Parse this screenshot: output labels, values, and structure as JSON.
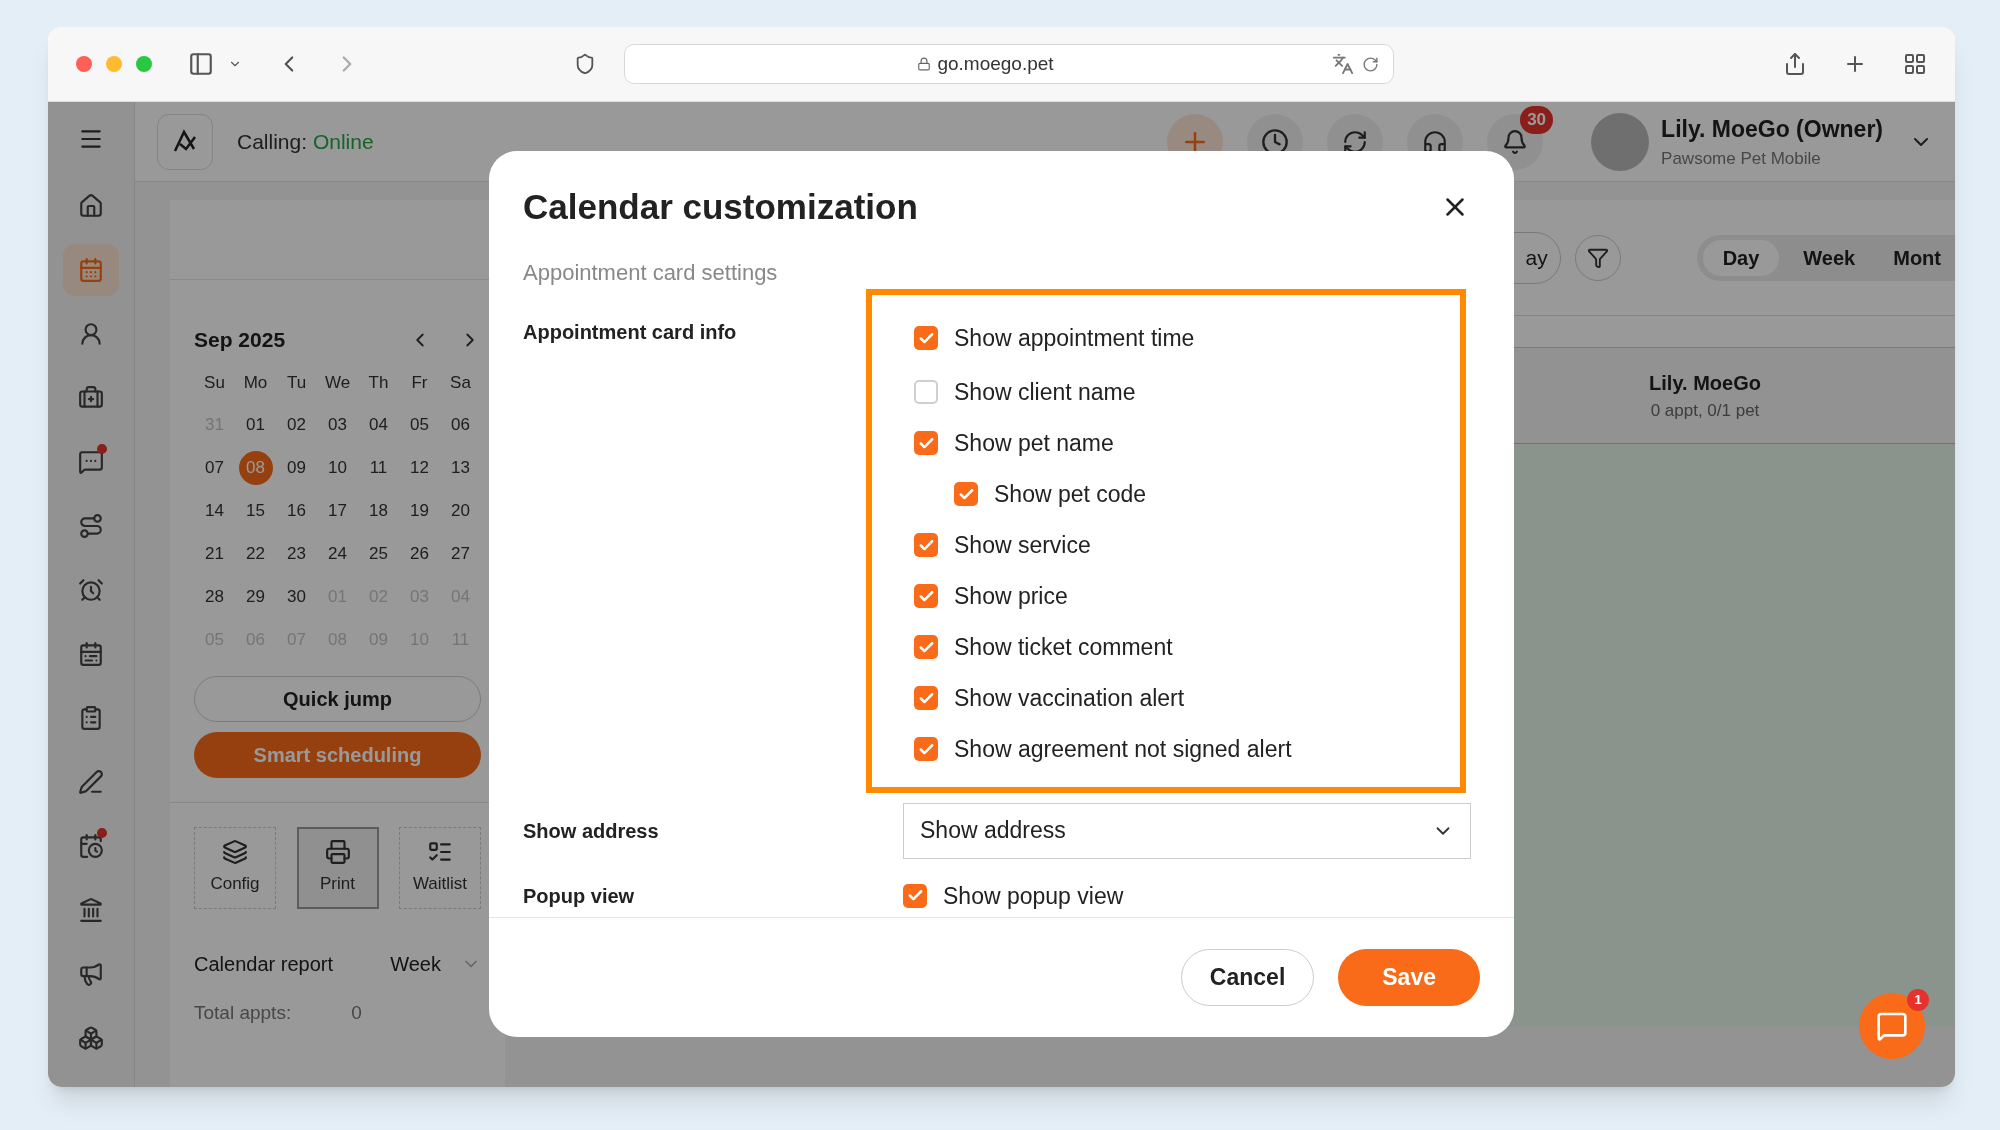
{
  "browser": {
    "url": "go.moego.pet"
  },
  "header": {
    "calling_label": "Calling:",
    "calling_status": "Online",
    "notification_count": "30",
    "user_name": "Lily. MoeGo (Owner)",
    "business": "Pawsome Pet Mobile"
  },
  "sidebar": {
    "items": [
      {
        "selected": false,
        "badge": false
      },
      {
        "selected": true,
        "badge": false
      },
      {
        "selected": false,
        "badge": false
      },
      {
        "selected": false,
        "badge": false
      },
      {
        "selected": false,
        "badge": true
      },
      {
        "selected": false,
        "badge": false
      },
      {
        "selected": false,
        "badge": false
      },
      {
        "selected": false,
        "badge": false
      },
      {
        "selected": false,
        "badge": false
      },
      {
        "selected": false,
        "badge": false
      },
      {
        "selected": false,
        "badge": true
      },
      {
        "selected": false,
        "badge": false
      },
      {
        "selected": false,
        "badge": false
      },
      {
        "selected": false,
        "badge": false
      }
    ]
  },
  "mini_calendar": {
    "month": "Sep 2025",
    "weekdays": [
      "Su",
      "Mo",
      "Tu",
      "We",
      "Th",
      "Fr",
      "Sa"
    ],
    "weeks": [
      [
        {
          "label": "31",
          "muted": true,
          "selected": false
        },
        {
          "label": "01",
          "muted": false,
          "selected": false
        },
        {
          "label": "02",
          "muted": false,
          "selected": false
        },
        {
          "label": "03",
          "muted": false,
          "selected": false
        },
        {
          "label": "04",
          "muted": false,
          "selected": false
        },
        {
          "label": "05",
          "muted": false,
          "selected": false
        },
        {
          "label": "06",
          "muted": false,
          "selected": false
        }
      ],
      [
        {
          "label": "07",
          "muted": false,
          "selected": false
        },
        {
          "label": "08",
          "muted": false,
          "selected": true
        },
        {
          "label": "09",
          "muted": false,
          "selected": false
        },
        {
          "label": "10",
          "muted": false,
          "selected": false
        },
        {
          "label": "11",
          "muted": false,
          "selected": false
        },
        {
          "label": "12",
          "muted": false,
          "selected": false
        },
        {
          "label": "13",
          "muted": false,
          "selected": false
        }
      ],
      [
        {
          "label": "14",
          "muted": false,
          "selected": false
        },
        {
          "label": "15",
          "muted": false,
          "selected": false
        },
        {
          "label": "16",
          "muted": false,
          "selected": false
        },
        {
          "label": "17",
          "muted": false,
          "selected": false
        },
        {
          "label": "18",
          "muted": false,
          "selected": false
        },
        {
          "label": "19",
          "muted": false,
          "selected": false
        },
        {
          "label": "20",
          "muted": false,
          "selected": false
        }
      ],
      [
        {
          "label": "21",
          "muted": false,
          "selected": false
        },
        {
          "label": "22",
          "muted": false,
          "selected": false
        },
        {
          "label": "23",
          "muted": false,
          "selected": false
        },
        {
          "label": "24",
          "muted": false,
          "selected": false
        },
        {
          "label": "25",
          "muted": false,
          "selected": false
        },
        {
          "label": "26",
          "muted": false,
          "selected": false
        },
        {
          "label": "27",
          "muted": false,
          "selected": false
        }
      ],
      [
        {
          "label": "28",
          "muted": false,
          "selected": false
        },
        {
          "label": "29",
          "muted": false,
          "selected": false
        },
        {
          "label": "30",
          "muted": false,
          "selected": false
        },
        {
          "label": "01",
          "muted": true,
          "selected": false
        },
        {
          "label": "02",
          "muted": true,
          "selected": false
        },
        {
          "label": "03",
          "muted": true,
          "selected": false
        },
        {
          "label": "04",
          "muted": true,
          "selected": false
        }
      ],
      [
        {
          "label": "05",
          "muted": true,
          "selected": false
        },
        {
          "label": "06",
          "muted": true,
          "selected": false
        },
        {
          "label": "07",
          "muted": true,
          "selected": false
        },
        {
          "label": "08",
          "muted": true,
          "selected": false
        },
        {
          "label": "09",
          "muted": true,
          "selected": false
        },
        {
          "label": "10",
          "muted": true,
          "selected": false
        },
        {
          "label": "11",
          "muted": true,
          "selected": false
        }
      ]
    ]
  },
  "quick_jump": "Quick jump",
  "smart_scheduling": "Smart scheduling",
  "tools": [
    {
      "label": "Config",
      "selected": false
    },
    {
      "label": "Print",
      "selected": true
    },
    {
      "label": "Waitlist",
      "selected": false
    }
  ],
  "report": {
    "label": "Calendar report",
    "period": "Week",
    "total_label": "Total appts:",
    "total_value": "0"
  },
  "toolbar": {
    "today_button": "ay",
    "views": [
      {
        "label": "Day",
        "selected": true
      },
      {
        "label": "Week",
        "selected": false
      },
      {
        "label": "Mont",
        "selected": false
      }
    ]
  },
  "staff_column": {
    "name": "Lily. MoeGo",
    "summary": "0 appt, 0/1 pet"
  },
  "modal": {
    "title": "Calendar customization",
    "section": "Appointment card settings",
    "card_info_label": "Appointment card info",
    "options": [
      {
        "label": "Show appointment time",
        "checked": true
      },
      {
        "label": "Show client name",
        "checked": false
      },
      {
        "label": "Show pet name",
        "checked": true,
        "children": [
          {
            "label": "Show pet code",
            "checked": true
          }
        ]
      },
      {
        "label": "Show service",
        "checked": true
      },
      {
        "label": "Show price",
        "checked": true
      },
      {
        "label": "Show ticket comment",
        "checked": true
      },
      {
        "label": "Show vaccination alert",
        "checked": true
      },
      {
        "label": "Show agreement not signed alert",
        "checked": true
      }
    ],
    "address_label": "Show address",
    "address_value": "Show address",
    "popup_label": "Popup view",
    "popup_option": {
      "label": "Show popup view",
      "checked": true
    },
    "cancel": "Cancel",
    "save": "Save"
  },
  "chat": {
    "badge": "1"
  }
}
